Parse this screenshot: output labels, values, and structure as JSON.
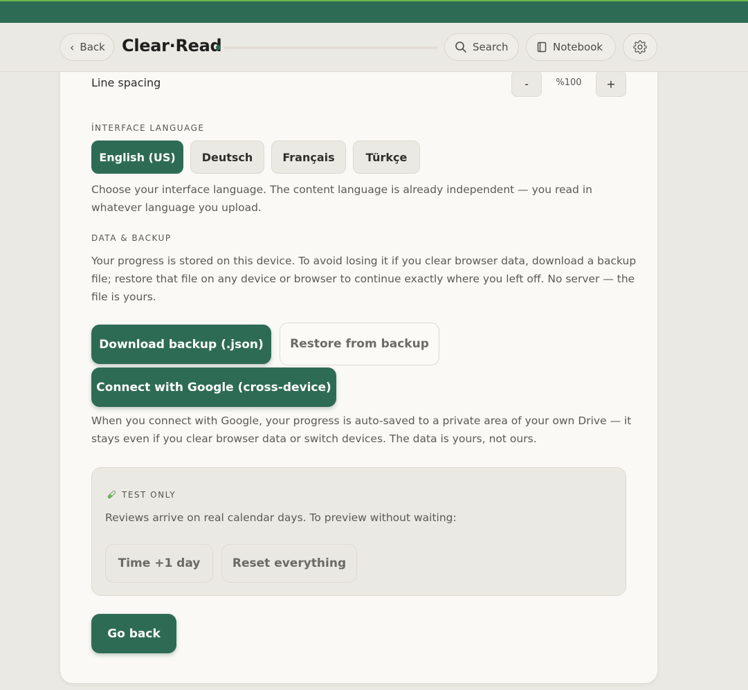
{
  "header": {
    "back_label": "Back",
    "back_chevron": "‹",
    "brand": "Clear·Read",
    "progress": 0,
    "search_label": "Search",
    "notebook_label": "Notebook"
  },
  "settings": {
    "line_spacing": {
      "label": "Line spacing",
      "minus": "-",
      "value": "%100",
      "plus": "+"
    },
    "interface_language": {
      "heading": "İNTERFACE LANGUAGE",
      "options": [
        "English (US)",
        "Deutsch",
        "Français",
        "Türkçe"
      ],
      "selected": "English (US)",
      "help": "Choose your interface language. The content language is already independent — you read in whatever language you upload."
    },
    "data_backup": {
      "heading": "DATA & BACKUP",
      "description": "Your progress is stored on this device. To avoid losing it if you clear browser data, download a backup file; restore that file on any device or browser to continue exactly where you left off. No server — the file is yours.",
      "download_label": "Download backup (.json)",
      "restore_label": "Restore from backup",
      "google_label": "Connect with Google (cross-device)",
      "google_help": "When you connect with Google, your progress is auto-saved to a private area of your own Drive — it stays even if you clear browser data or switch devices. The data is yours, not ours."
    },
    "test_only": {
      "icon": "test-tube-icon",
      "heading": "TEST ONLY",
      "description": "Reviews arrive on real calendar days. To preview without waiting:",
      "time_label": "Time +1 day",
      "reset_label": "Reset everything"
    },
    "go_back_label": "Go back"
  },
  "colors": {
    "accent": "#2e6b55",
    "top_stripe": "#6bb84a",
    "background": "#ebe9e3",
    "card": "#faf9f5"
  }
}
